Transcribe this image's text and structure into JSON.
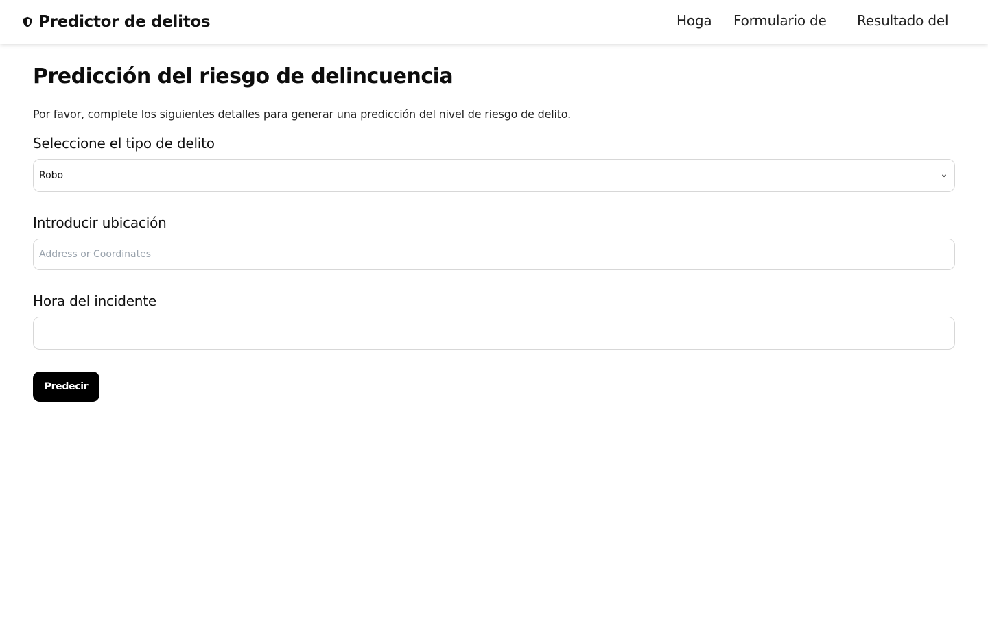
{
  "app": {
    "title": "Predictor de delitos",
    "icon": "shield-icon"
  },
  "nav": {
    "items": [
      {
        "label": "Hoga"
      },
      {
        "label": "Formulario de"
      },
      {
        "label": "Resultado del"
      }
    ]
  },
  "main": {
    "title": "Predicción del riesgo de delincuencia",
    "intro": "Por favor, complete los siguientes detalles para generar una predicción del nivel de riesgo de delito.",
    "crime_type": {
      "label": "Seleccione el tipo de delito",
      "selected": "Robo",
      "icon": "chevron-down-icon"
    },
    "location": {
      "label": "Introducir ubicación",
      "value": "",
      "placeholder": "Address or Coordinates"
    },
    "time": {
      "label": "Hora del incidente",
      "value": ""
    },
    "submit_label": "Predecir"
  },
  "colors": {
    "button_bg": "#000000",
    "button_text": "#ffffff",
    "border": "#d7d7d7",
    "placeholder": "#9aa3ad"
  }
}
